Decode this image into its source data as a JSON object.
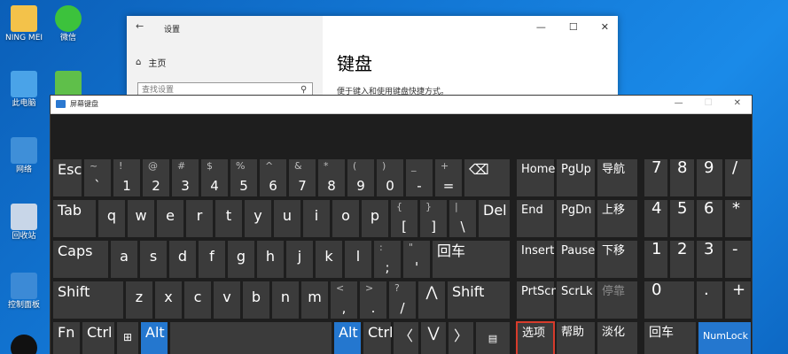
{
  "desktop": {
    "icons": [
      {
        "id": "user",
        "label": "NING MEI",
        "color": "#f3c24a"
      },
      {
        "id": "wechat",
        "label": "微信",
        "color": "#3cc23c"
      },
      {
        "id": "computer",
        "label": "此电脑",
        "color": "#4aa3e8"
      },
      {
        "id": "app",
        "label": "",
        "color": "#5fbf4a"
      },
      {
        "id": "network",
        "label": "网络",
        "color": "#3f8fd8"
      },
      {
        "id": "recycle",
        "label": "回收站",
        "color": "#c8d6e8"
      },
      {
        "id": "control",
        "label": "控制面板",
        "color": "#3c8ad6"
      },
      {
        "id": "qq",
        "label": "",
        "color": "#111111"
      }
    ]
  },
  "settings": {
    "title": "设置",
    "home": "主页",
    "search_placeholder": "查找设置",
    "heading": "键盘",
    "description": "便于键入和使用键盘快捷方式。"
  },
  "osk": {
    "title": "屏幕键盘",
    "keys": {
      "esc": "Esc",
      "n1_top": "!",
      "n1": "1",
      "n2_top": "@",
      "n2": "2",
      "n3_top": "#",
      "n3": "3",
      "n4_top": "$",
      "n4": "4",
      "n5_top": "%",
      "n5": "5",
      "n6_top": "^",
      "n6": "6",
      "n7_top": "&",
      "n7": "7",
      "n8_top": "*",
      "n8": "8",
      "n9_top": "(",
      "n9": "9",
      "n0_top": ")",
      "n0": "0",
      "minus_top": "_",
      "minus": "-",
      "plus_top": "+",
      "plus": "=",
      "tilde_top": "~",
      "tilde": "`",
      "backspace": "⌫",
      "tab": "Tab",
      "q": "q",
      "w": "w",
      "e": "e",
      "r": "r",
      "t": "t",
      "y": "y",
      "u": "u",
      "i": "i",
      "o": "o",
      "p": "p",
      "lbr_top": "{",
      "lbr": "[",
      "rbr_top": "}",
      "rbr": "]",
      "bs_top": "|",
      "bs": "\\",
      "del": "Del",
      "caps": "Caps",
      "a": "a",
      "s": "s",
      "d": "d",
      "f": "f",
      "g": "g",
      "h": "h",
      "j": "j",
      "k": "k",
      "l": "l",
      "semi_top": ":",
      "semi": ";",
      "quote_top": "\"",
      "quote": "'",
      "enter": "回车",
      "shift": "Shift",
      "z": "z",
      "x": "x",
      "c": "c",
      "v": "v",
      "b": "b",
      "n": "n",
      "m": "m",
      "comma_top": "<",
      "comma": ",",
      "period_top": ">",
      "period": ".",
      "slash_top": "?",
      "slash": "/",
      "up": "⋀",
      "fn": "Fn",
      "ctrl": "Ctrl",
      "alt": "Alt",
      "left": "〈",
      "down": "⋁",
      "right": "〉",
      "home": "Home",
      "pgup": "PgUp",
      "nav": "导航",
      "end": "End",
      "pgdn": "PgDn",
      "moveup": "上移",
      "insert": "Insert",
      "pause": "Pause",
      "movedown": "下移",
      "prtscn": "PrtScn",
      "scrlk": "ScrLk",
      "dock": "停靠",
      "options": "选项",
      "help": "帮助",
      "fade": "淡化",
      "np7": "7",
      "np8": "8",
      "np9": "9",
      "npdiv": "/",
      "np4": "4",
      "np5": "5",
      "np6": "6",
      "npmul": "*",
      "np1": "1",
      "np2": "2",
      "np3": "3",
      "npminus": "-",
      "np0": "0",
      "npdot": ".",
      "npplus": "+",
      "npenter": "回车",
      "numlock": "NumLock"
    }
  }
}
